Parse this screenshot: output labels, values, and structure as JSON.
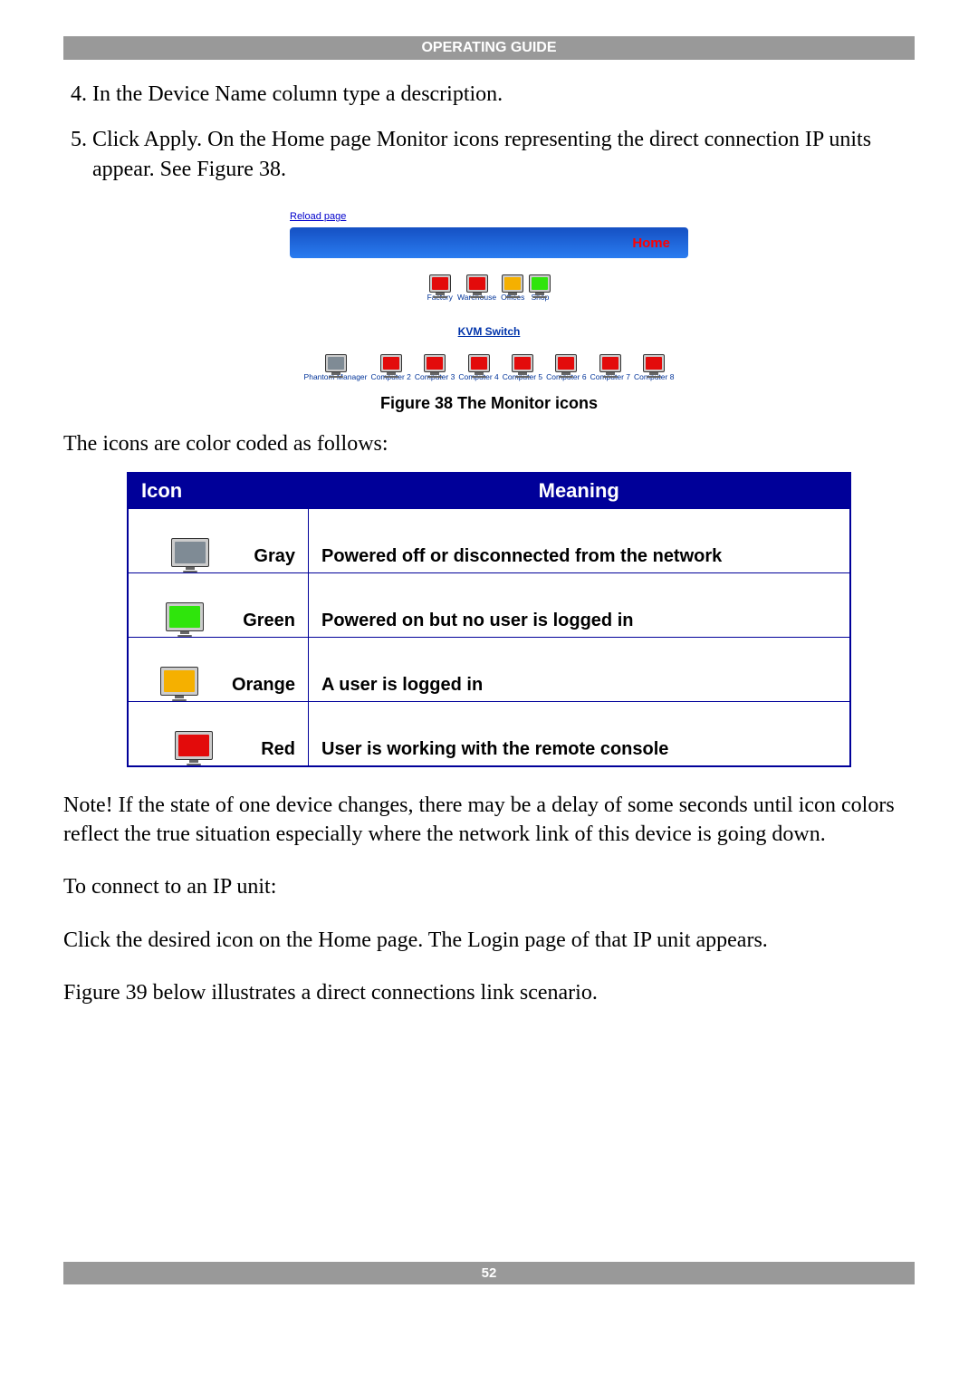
{
  "header": "OPERATING GUIDE",
  "page_number": "52",
  "steps": [
    {
      "n": "4",
      "text": "In the Device Name column type a description."
    },
    {
      "n": "5",
      "text": "Click Apply. On the Home page Monitor icons representing the direct connection IP units appear. See Figure 38."
    }
  ],
  "screenshot": {
    "reload": "Reload page",
    "home": "Home",
    "top_row": [
      {
        "color": "red",
        "label": "Factory"
      },
      {
        "color": "red",
        "label": "Warehouse"
      },
      {
        "color": "orange",
        "label": "Offices"
      },
      {
        "color": "green",
        "label": "Shop"
      }
    ],
    "kvm_label": "KVM Switch",
    "bottom_row": [
      {
        "color": "gray",
        "label": "Phantom Manager"
      },
      {
        "color": "red",
        "label": "Computer 2"
      },
      {
        "color": "red",
        "label": "Computer 3"
      },
      {
        "color": "red",
        "label": "Computer 4"
      },
      {
        "color": "red",
        "label": "Computer 5"
      },
      {
        "color": "red",
        "label": "Computer 6"
      },
      {
        "color": "red",
        "label": "Computer 7"
      },
      {
        "color": "red",
        "label": "Computer 8"
      }
    ],
    "caption": "Figure 38 The Monitor icons"
  },
  "intro_line": "The icons are color coded as follows:",
  "legend": {
    "head_icon": "Icon",
    "head_meaning": "Meaning",
    "rows": [
      {
        "color": "gray",
        "name": "Gray",
        "meaning": "Powered off or disconnected from the network"
      },
      {
        "color": "green",
        "name": "Green",
        "meaning": "Powered on but no user is logged in"
      },
      {
        "color": "orange",
        "name": "Orange",
        "meaning": "A user is logged in"
      },
      {
        "color": "red",
        "name": "Red",
        "meaning": "User is working with the remote console"
      }
    ]
  },
  "paragraphs": [
    "Note! If the state of one device changes, there may be a delay of some seconds until icon colors reflect the true situation especially where the network link of this device is going down.",
    "To connect to an IP unit:",
    "Click the desired icon on the Home page. The Login page of that IP unit appears.",
    "Figure 39 below illustrates a direct connections link scenario."
  ]
}
